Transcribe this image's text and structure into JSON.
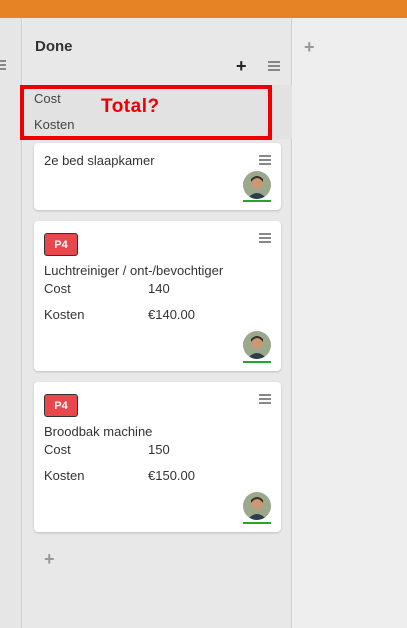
{
  "column": {
    "title": "Done",
    "summary": {
      "cost_label": "Cost",
      "kosten_label": "Kosten"
    },
    "annotation": "Total?"
  },
  "cards": [
    {
      "title": "2e bed slaapkamer"
    },
    {
      "badge": "P4",
      "title": "Luchtreiniger / ont-/bevochtiger",
      "cost_label": "Cost",
      "cost_value": "140",
      "kosten_label": "Kosten",
      "kosten_value": "€140.00"
    },
    {
      "badge": "P4",
      "title": "Broodbak machine",
      "cost_label": "Cost",
      "cost_value": "150",
      "kosten_label": "Kosten",
      "kosten_value": "€150.00"
    }
  ],
  "colors": {
    "topbar": "#e58325",
    "badge": "#e8474c",
    "annotation": "#ee0000",
    "avatar_underline": "#2aa32a"
  },
  "icons": [
    "plus-icon",
    "hamburger-menu-icon",
    "avatar"
  ]
}
